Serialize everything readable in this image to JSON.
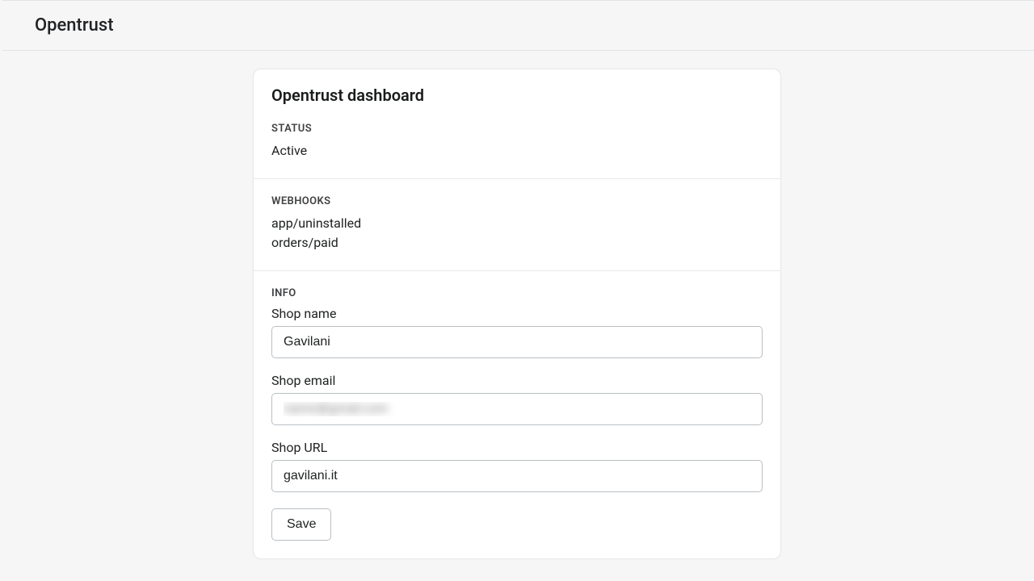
{
  "header": {
    "title": "Opentrust"
  },
  "card": {
    "title": "Opentrust dashboard",
    "status": {
      "label": "Status",
      "value": "Active"
    },
    "webhooks": {
      "label": "Webhooks",
      "items": [
        "app/uninstalled",
        "orders/paid"
      ]
    },
    "info": {
      "label": "Info",
      "shop_name": {
        "label": "Shop name",
        "value": "Gavilani"
      },
      "shop_email": {
        "label": "Shop email",
        "value": "name@gmail.com"
      },
      "shop_url": {
        "label": "Shop URL",
        "value": "gavilani.it"
      },
      "save_label": "Save"
    }
  }
}
